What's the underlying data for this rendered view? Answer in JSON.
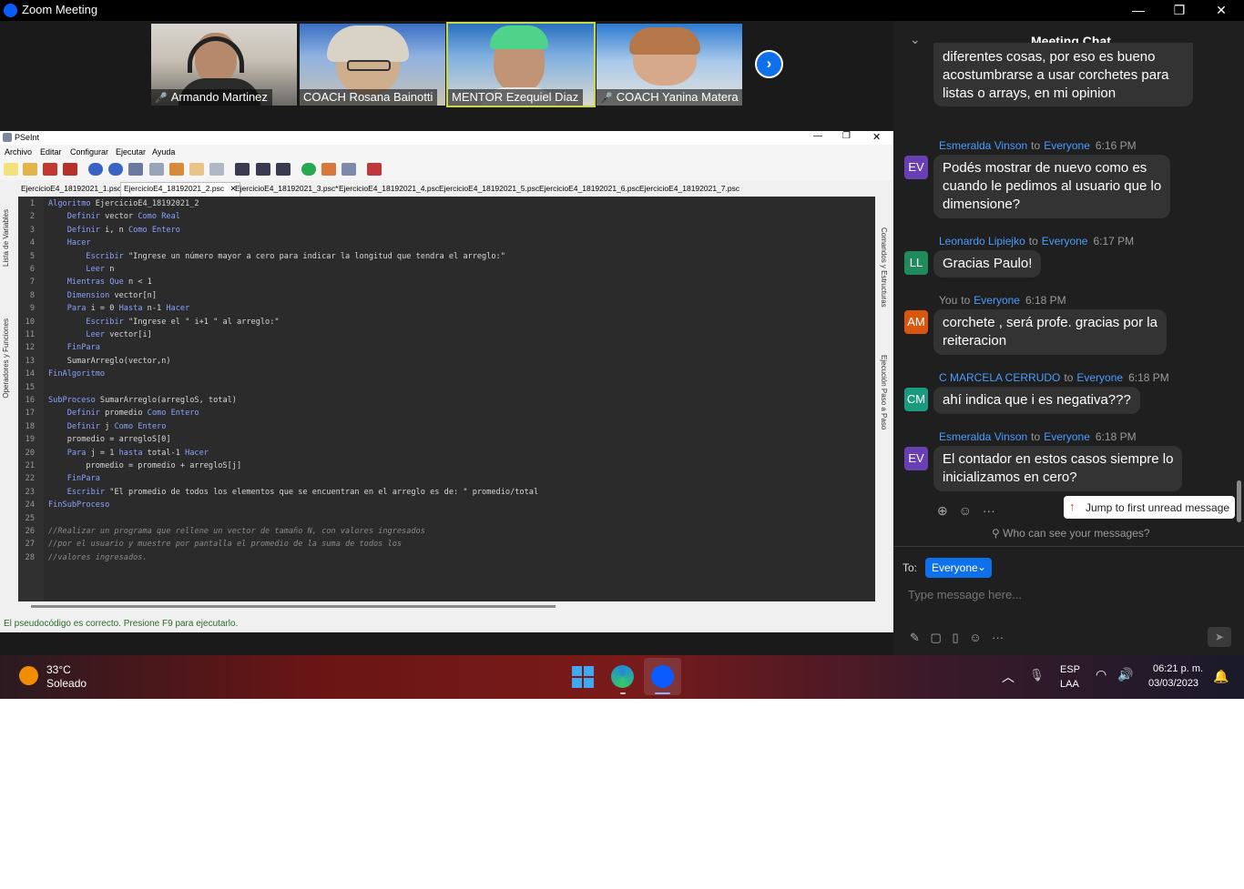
{
  "zoom": {
    "window_title": "Zoom Meeting",
    "min_glyph": "—",
    "restore_glyph": "❐",
    "close_glyph": "✕",
    "participants": [
      {
        "name": "Armando Martinez",
        "muted": true
      },
      {
        "name": "COACH Rosana Bainotti",
        "muted": false
      },
      {
        "name": "MENTOR Ezequiel Diaz",
        "muted": false
      },
      {
        "name": "COACH Yanina Matera",
        "muted": true
      }
    ],
    "next_arrow": "›"
  },
  "pseint": {
    "window_title": "PSeInt",
    "menu": [
      "Archivo",
      "Editar",
      "Configurar",
      "Ejecutar",
      "Ayuda"
    ],
    "tabs": [
      "EjercicioE4_18192021_1.psc*",
      "EjercicioE4_18192021_2.psc",
      "EjercicioE4_18192021_3.psc*",
      "EjercicioE4_18192021_4.psc",
      "EjercicioE4_18192021_5.psc",
      "EjercicioE4_18192021_6.psc",
      "EjercicioE4_18192021_7.psc"
    ],
    "tab_close": "✕",
    "left_panel_labels": [
      "Lista de Variables",
      "Operadores y Funciones"
    ],
    "right_panel_labels": [
      "Comandos y Estructuras",
      "Ejecución Paso a Paso"
    ],
    "code_lines": [
      "Algoritmo EjercicioE4_18192021_2",
      "    Definir vector Como Real",
      "    Definir i, n Como Entero",
      "    Hacer",
      "        Escribir \"Ingrese un número mayor a cero para indicar la longitud que tendra el arreglo:\"",
      "        Leer n",
      "    Mientras Que n < 1",
      "    Dimension vector[n]",
      "    Para i = 0 Hasta n-1 Hacer",
      "        Escribir \"Ingrese el \" i+1 \" al arreglo:\"",
      "        Leer vector[i]",
      "    FinPara",
      "    SumarArreglo(vector,n)",
      "FinAlgoritmo",
      "",
      "SubProceso SumarArreglo(arregloS, total)",
      "    Definir promedio Como Entero",
      "    Definir j Como Entero",
      "    promedio = arregloS[0]",
      "    Para j = 1 hasta total-1 Hacer",
      "        promedio = promedio + arregloS[j]",
      "    FinPara",
      "    Escribir \"El promedio de todos los elementos que se encuentran en el arreglo es de: \" promedio/total",
      "FinSubProceso",
      "",
      "//Realizar un programa que rellene un vector de tamaño N, con valores ingresados",
      "//por el usuario y muestre por pantalla el promedio de la suma de todos los",
      "//valores ingresados."
    ],
    "status_text": "El pseudocódigo es correcto. Presione F9 para ejecutarlo."
  },
  "chat": {
    "header_title": "Meeting Chat",
    "collapse_glyph": "⌄",
    "partial_message": "corchetes y llaves se usan para diferentes cosas, por eso es bueno acostumbrarse a usar corchetes para listas o arrays, en mi opinion",
    "partial_visible": [
      "diferentes cosas, por eso es bueno",
      "acostumbrarse a usar corchetes para",
      "listas o arrays, en mi opinion"
    ],
    "messages": [
      {
        "initials": "EV",
        "color": "#6a3fb5",
        "sender": "Esmeralda Vinson",
        "to": "to",
        "recipient": "Everyone",
        "time": "6:16 PM",
        "lines": [
          "Podés mostrar de nuevo como es",
          "cuando le pedimos al usuario que lo",
          "dimensione?"
        ]
      },
      {
        "initials": "LL",
        "color": "#1f8a5a",
        "sender": "Leonardo Lipiejko",
        "to": "to",
        "recipient": "Everyone",
        "time": "6:17 PM",
        "lines": [
          "Gracias Paulo!"
        ]
      },
      {
        "initials": "AM",
        "color": "#d9560f",
        "sender": "You",
        "to": "to",
        "recipient": "Everyone",
        "time": "6:18 PM",
        "lines": [
          "corchete , será profe. gracias por la",
          "reiteracion"
        ]
      },
      {
        "initials": "CM",
        "color": "#1a9a80",
        "sender": "C MARCELA CERRUDO",
        "to": "to",
        "recipient": "Everyone",
        "time": "6:18 PM",
        "lines": [
          "ahí indica que i es negativa???"
        ]
      },
      {
        "initials": "EV",
        "color": "#6a3fb5",
        "sender": "Esmeralda Vinson",
        "to": "to",
        "recipient": "Everyone",
        "time": "6:18 PM",
        "lines": [
          "El contador en estos casos siempre lo",
          "inicializamos en cero?"
        ]
      }
    ],
    "jump_label": "Jump to first unread message",
    "who_can_see": "Who can see your messages?",
    "to_label": "To:",
    "to_value": "Everyone",
    "input_placeholder": "Type message here..."
  },
  "taskbar": {
    "temperature": "33°C",
    "weather": "Soleado",
    "lang_top": "ESP",
    "lang_bottom": "LAA",
    "time": "06:21 p. m.",
    "date": "03/03/2023"
  }
}
